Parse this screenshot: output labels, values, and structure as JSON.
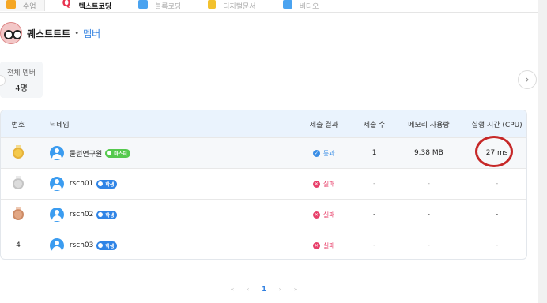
{
  "tabs": [
    {
      "label": "수업",
      "icon": "class-icon",
      "color": "#f5a623"
    },
    {
      "label": "텍스트코딩",
      "icon": "q-icon",
      "color": "#e8334f"
    },
    {
      "label": "블록코딩",
      "icon": "block-coding-icon",
      "color": "#4aa3f0"
    },
    {
      "label": "디지털문서",
      "icon": "document-icon",
      "color": "#f2c12e"
    },
    {
      "label": "비디오",
      "icon": "video-icon",
      "color": "#4aa3f0"
    }
  ],
  "header": {
    "name": "퀘스트트트",
    "separator": "•",
    "role": "멤버"
  },
  "summary": {
    "label": "전체 멤버",
    "count": "4명"
  },
  "table": {
    "columns": [
      "번호",
      "닉네임",
      "제출 결과",
      "제출 수",
      "메모리 사용량",
      "실행 시간 (CPU)"
    ],
    "rows": [
      {
        "rank": "",
        "medal": "gold",
        "nick": "둘런연구원",
        "badge": "마스터",
        "badge_type": "master",
        "result": "통과",
        "result_type": "pass",
        "submissions": "1",
        "memory": "9.38 MB",
        "time": "27 ms"
      },
      {
        "rank": "",
        "medal": "silver",
        "nick": "rsch01",
        "badge": "학생",
        "badge_type": "student",
        "result": "실패",
        "result_type": "fail",
        "submissions": "-",
        "memory": "-",
        "time": "-"
      },
      {
        "rank": "",
        "medal": "bronze",
        "nick": "rsch02",
        "badge": "학생",
        "badge_type": "student",
        "result": "실패",
        "result_type": "fail",
        "submissions": "-",
        "memory": "-",
        "time": "-"
      },
      {
        "rank": "4",
        "medal": "",
        "nick": "rsch03",
        "badge": "학생",
        "badge_type": "student",
        "result": "실패",
        "result_type": "fail",
        "submissions": "-",
        "memory": "-",
        "time": "-"
      }
    ]
  },
  "pagination": {
    "first": "«",
    "prev": "‹",
    "current": "1",
    "next": "›",
    "last": "»"
  }
}
